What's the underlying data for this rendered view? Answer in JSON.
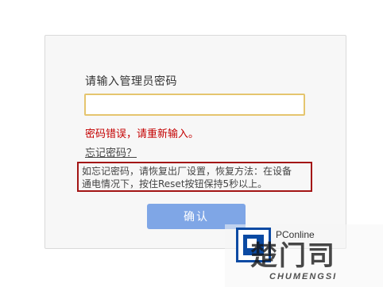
{
  "login": {
    "title": "请输入管理员密码",
    "password_value": "",
    "error_message": "密码错误，请重新输入。",
    "forgot_link": "忘记密码？",
    "help_text_line1": "如忘记密码，请恢复出厂设置，恢复方法：在设备",
    "help_text_line2": "通电情况下，按住Reset按钮保持5秒以上。",
    "confirm_label": "确认"
  },
  "watermark": {
    "brand": "PConline",
    "big_text": "楚门司",
    "small_text": "CHUMENGSI"
  },
  "colors": {
    "input_border": "#e5c56e",
    "error_text": "#c40000",
    "help_box_border": "#a31515",
    "button_bg": "#7fa6e6"
  }
}
